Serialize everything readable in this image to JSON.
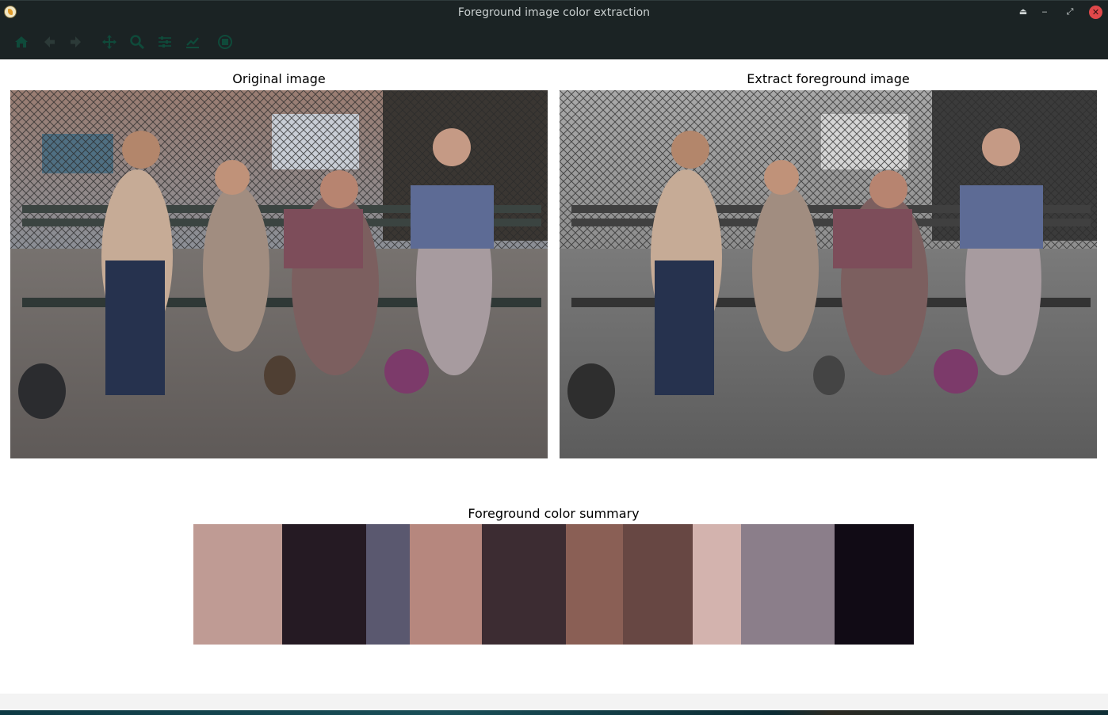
{
  "window": {
    "title": "Foreground image color extraction",
    "controls": [
      "eject-icon",
      "minimize-icon",
      "restore-icon",
      "close-icon"
    ]
  },
  "toolbar": {
    "buttons": [
      {
        "name": "home-button",
        "icon": "home-icon"
      },
      {
        "name": "back-button",
        "icon": "arrow-left-icon"
      },
      {
        "name": "forward-button",
        "icon": "arrow-right-icon"
      },
      {
        "name": "pan-button",
        "icon": "move-icon"
      },
      {
        "name": "zoom-button",
        "icon": "magnifier-icon"
      },
      {
        "name": "subplots-button",
        "icon": "sliders-icon"
      },
      {
        "name": "edit-axes-button",
        "icon": "chart-line-icon"
      },
      {
        "name": "save-button",
        "icon": "save-icon"
      }
    ],
    "icon_color": "#0f4a3a"
  },
  "figure": {
    "original": {
      "title": "Original image"
    },
    "extracted": {
      "title": "Extract foreground image"
    },
    "summary": {
      "title": "Foreground color summary"
    }
  },
  "chart_data": {
    "type": "bar",
    "title": "Foreground color summary",
    "orientation": "horizontal-stacked",
    "series": [
      {
        "color": "#bf9b94",
        "value": 112
      },
      {
        "color": "#251a23",
        "value": 106
      },
      {
        "color": "#5a586f",
        "value": 55
      },
      {
        "color": "#b6877e",
        "value": 91
      },
      {
        "color": "#3c2c32",
        "value": 106
      },
      {
        "color": "#8a5f55",
        "value": 72
      },
      {
        "color": "#674743",
        "value": 88
      },
      {
        "color": "#d3b3ae",
        "value": 61
      },
      {
        "color": "#8b7e8a",
        "value": 118
      },
      {
        "color": "#110b15",
        "value": 100
      }
    ]
  }
}
